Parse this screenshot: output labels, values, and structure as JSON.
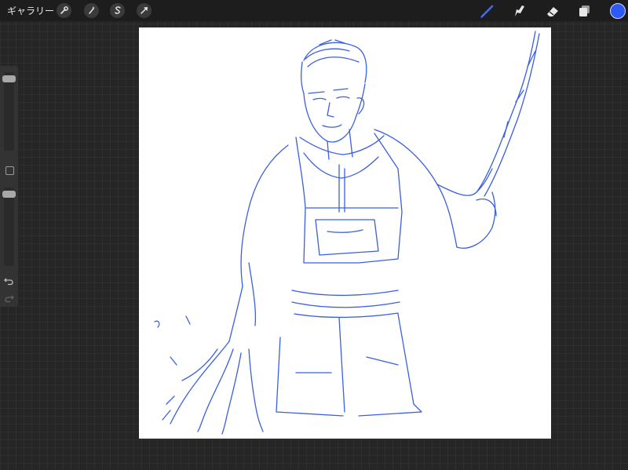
{
  "topbar": {
    "gallery_label": "ギャラリー",
    "left_tools": [
      "wrench-icon",
      "magic-wand-icon",
      "selection-s-icon",
      "transform-arrow-icon"
    ],
    "right_tools": [
      "brush-icon",
      "smudge-icon",
      "eraser-icon",
      "layers-icon"
    ],
    "active_tool": "brush",
    "active_color": "#2d59f5",
    "icon_color_active": "#3b6cff",
    "icon_color_default": "#e6e6e6"
  },
  "sidebar": {
    "brush_size_level": 0.04,
    "opacity_level": 0.04,
    "buttons": [
      "modify-button",
      "undo-icon",
      "redo-icon"
    ]
  },
  "canvas": {
    "background": "#ffffff",
    "stroke_color": "#3a5fe0"
  }
}
